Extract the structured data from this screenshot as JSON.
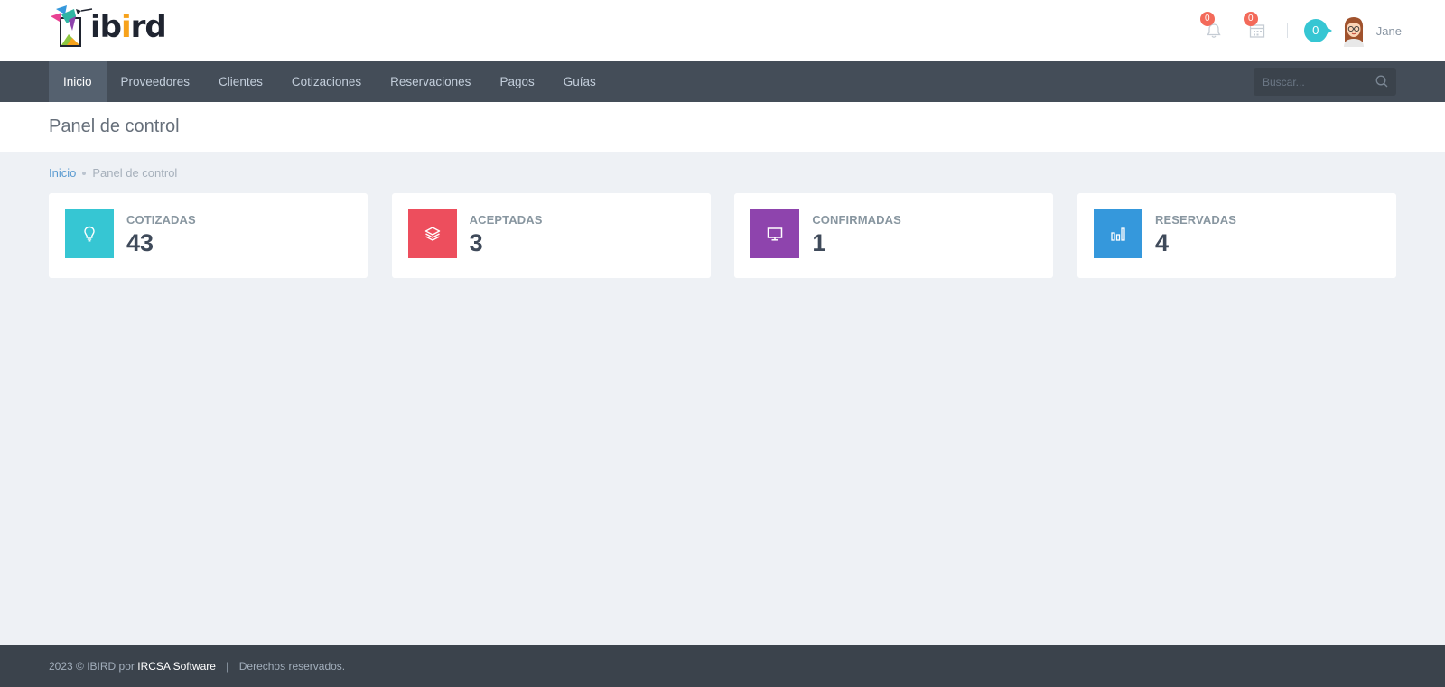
{
  "header": {
    "logo_text_prefix": "ib",
    "logo_text_o": "i",
    "logo_text_suffix": "rd",
    "notifications_count": "0",
    "calendar_count": "0",
    "inbox_count": "0",
    "username": "Jane"
  },
  "nav": {
    "items": [
      {
        "label": "Inicio"
      },
      {
        "label": "Proveedores"
      },
      {
        "label": "Clientes"
      },
      {
        "label": "Cotizaciones"
      },
      {
        "label": "Reservaciones"
      },
      {
        "label": "Pagos"
      },
      {
        "label": "Guías"
      }
    ],
    "active_index": 0,
    "search_placeholder": "Buscar..."
  },
  "page": {
    "title": "Panel de control"
  },
  "breadcrumb": {
    "home": "Inicio",
    "current": "Panel de control"
  },
  "stats": [
    {
      "label": "COTIZADAS",
      "value": "43",
      "color": "#36c6d3",
      "icon": "lightbulb-icon"
    },
    {
      "label": "ACEPTADAS",
      "value": "3",
      "color": "#ed4e5d",
      "icon": "layers-icon"
    },
    {
      "label": "CONFIRMADAS",
      "value": "1",
      "color": "#8e44ad",
      "icon": "monitor-icon"
    },
    {
      "label": "RESERVADAS",
      "value": "4",
      "color": "#3598dc",
      "icon": "bar-chart-icon"
    }
  ],
  "footer": {
    "prefix": "2023 © IBIRD por",
    "brand": "IRCSA Software",
    "pipe": "|",
    "rights": "Derechos reservados."
  },
  "colors": {
    "topbar": "#ffffff",
    "navbar": "#444d58",
    "nav_active": "#55616f",
    "body_bg": "#eef1f5",
    "footer_bg": "#3b434c",
    "badge_red": "#f36a5a",
    "badge_teal": "#36c6d3"
  }
}
